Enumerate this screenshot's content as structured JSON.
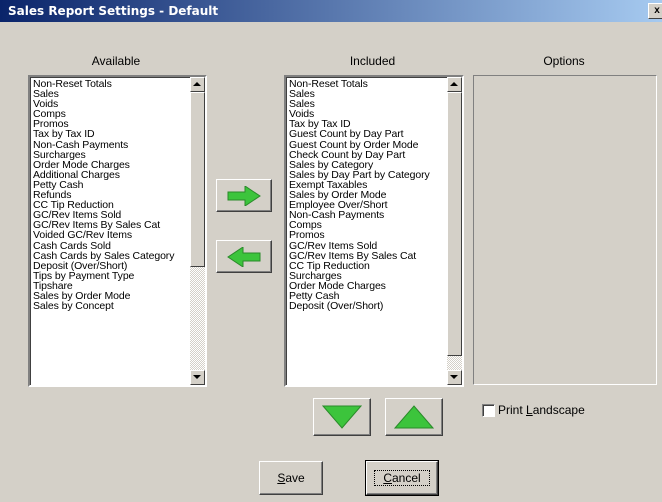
{
  "window": {
    "title": "Sales Report Settings - Default",
    "close_glyph": "x"
  },
  "columns": {
    "available": "Available",
    "included": "Included",
    "options": "Options"
  },
  "available_items": [
    "Non-Reset Totals",
    "Sales",
    "Voids",
    "Comps",
    "Promos",
    "Tax by Tax ID",
    "Non-Cash Payments",
    "Surcharges",
    "Order Mode Charges",
    "Additional Charges",
    "Petty Cash",
    "Refunds",
    "CC Tip Reduction",
    "GC/Rev Items Sold",
    "GC/Rev Items By Sales Cat",
    "Voided GC/Rev Items",
    "Cash Cards Sold",
    "Cash Cards by Sales Category",
    "Deposit (Over/Short)",
    "Tips by Payment Type",
    "Tipshare",
    "Sales by Order Mode",
    "Sales by Concept"
  ],
  "included_items": [
    "Non-Reset Totals",
    "Sales",
    "Sales",
    "Voids",
    "Tax by Tax ID",
    "Guest Count by Day Part",
    "Guest Count by Order Mode",
    "Check Count by Day Part",
    "Sales by Category",
    "Sales by Day Part by Category",
    "Exempt Taxables",
    "Sales by Order Mode",
    "Employee Over/Short",
    "Non-Cash Payments",
    "Comps",
    "Promos",
    "GC/Rev Items Sold",
    "GC/Rev Items By Sales Cat",
    "CC Tip Reduction",
    "Surcharges",
    "Order Mode Charges",
    "Petty Cash",
    "Deposit (Over/Short)"
  ],
  "icons": {
    "add": "arrow-right-icon",
    "remove": "arrow-left-icon",
    "move_down": "triangle-down-icon",
    "move_up": "triangle-up-icon",
    "arrow_color": "#3cc43c"
  },
  "print_landscape": {
    "label_pre": "Print ",
    "label_accel": "L",
    "label_post": "andscape",
    "checked": false
  },
  "buttons": {
    "save": {
      "accel": "S",
      "rest": "ave"
    },
    "cancel": {
      "accel": "C",
      "rest": "ancel"
    }
  }
}
